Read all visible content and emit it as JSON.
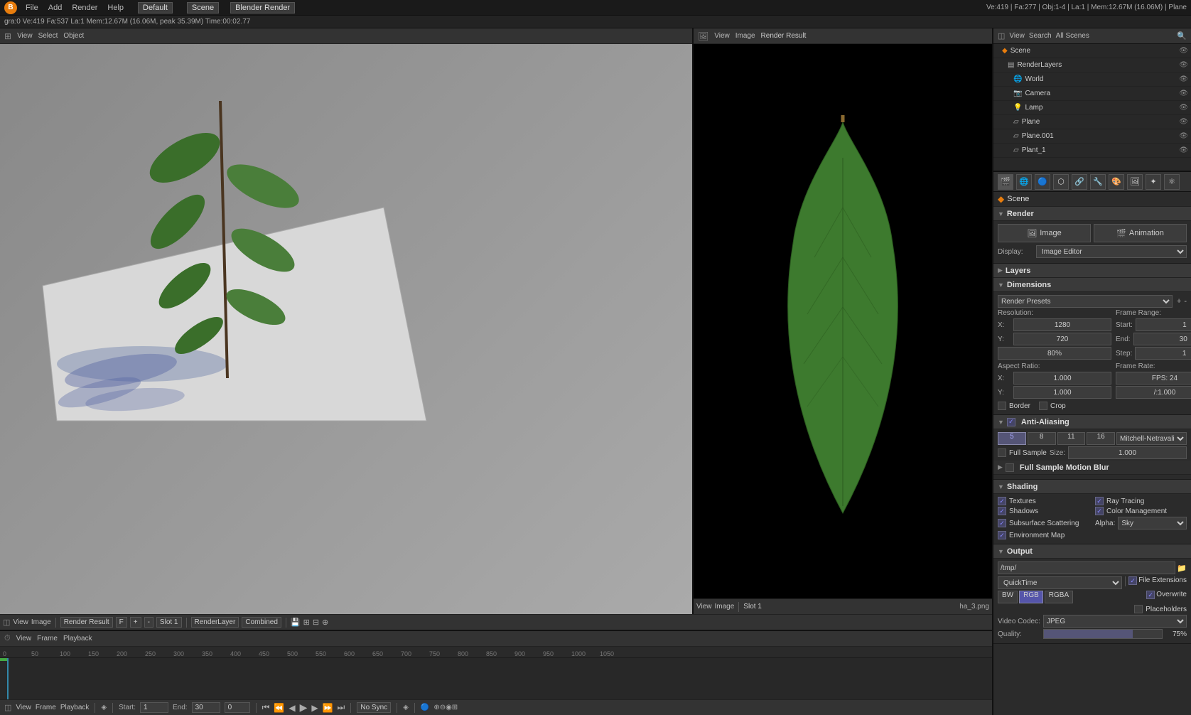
{
  "topbar": {
    "logo": "B",
    "menus": [
      "File",
      "Add",
      "Render",
      "Help"
    ],
    "layout": "Default",
    "scene": "Scene",
    "render_engine": "Blender Render",
    "info": "Ve:419 | Fa:277 | Obj:1-4 | La:1 | Mem:12.67M (16.06M) | Plane"
  },
  "infobar": {
    "text": "gra:0  Ve:419 Fa:537 La:1 Mem:12.67M (16.06M, peak 35.39M) Time:00:02.77"
  },
  "viewport3d": {
    "header_items": [
      "View",
      "Select",
      "Object"
    ]
  },
  "viewport_render": {
    "title": "Render Result",
    "slot": "Slot 1",
    "render_layer": "RenderLayer",
    "combined": "Combined"
  },
  "outliner": {
    "title": "Scene",
    "items": [
      {
        "indent": 0,
        "icon": "◆",
        "label": "Scene"
      },
      {
        "indent": 1,
        "icon": "▤",
        "label": "RenderLayers"
      },
      {
        "indent": 2,
        "icon": "🌐",
        "label": "World"
      },
      {
        "indent": 2,
        "icon": "📷",
        "label": "Camera"
      },
      {
        "indent": 2,
        "icon": "💡",
        "label": "Lamp"
      },
      {
        "indent": 2,
        "icon": "▱",
        "label": "Plane"
      },
      {
        "indent": 2,
        "icon": "▱",
        "label": "Plane.001"
      },
      {
        "indent": 2,
        "icon": "▱",
        "label": "Plant_1"
      }
    ]
  },
  "properties": {
    "scene_label": "Scene",
    "sections": {
      "render": {
        "label": "Render",
        "image_btn": "Image",
        "animation_btn": "Animation",
        "display_label": "Display:",
        "display_value": "Image Editor"
      },
      "layers": {
        "label": "Layers"
      },
      "dimensions": {
        "label": "Dimensions",
        "presets_label": "Render Presets",
        "resolution_label": "Resolution:",
        "x_label": "X:",
        "x_value": "1280",
        "y_label": "Y:",
        "y_value": "720",
        "percent": "80%",
        "frame_range_label": "Frame Range:",
        "start_label": "Start:",
        "start_value": "1",
        "end_label": "End:",
        "end_value": "30",
        "step_label": "Step:",
        "step_value": "1",
        "aspect_label": "Aspect Ratio:",
        "ax_value": "1.000",
        "ay_value": "1.000",
        "fps_label": "Frame Rate:",
        "fps_value": "FPS: 24",
        "fps_multiplier": "/:1.000",
        "border_label": "Border",
        "crop_label": "Crop"
      },
      "anti_aliasing": {
        "label": "Anti-Aliasing",
        "samples": [
          "5",
          "8",
          "11",
          "16"
        ],
        "active_sample": "5",
        "filter": "Mitchell-Netravali",
        "full_sample_label": "Full Sample",
        "size_label": "Size:",
        "size_value": "1.000",
        "motion_blur_label": "Full Sample Motion Blur"
      },
      "shading": {
        "label": "Shading",
        "items": [
          {
            "label": "Textures",
            "checked": true
          },
          {
            "label": "Ray Tracing",
            "checked": true
          },
          {
            "label": "Shadows",
            "checked": true
          },
          {
            "label": "Color Management",
            "checked": true
          },
          {
            "label": "Subsurface Scattering",
            "checked": true
          },
          {
            "label": "Alpha:",
            "type": "dropdown",
            "value": "Sky"
          },
          {
            "label": "Environment Map",
            "checked": true
          }
        ]
      },
      "output": {
        "label": "Output",
        "path": "/tmp/",
        "format_quicktime": "QuickTime",
        "bw": "BW",
        "rgb": "RGB",
        "rgba": "RGBA",
        "file_extensions_label": "File Extensions",
        "overwrite_label": "Overwrite",
        "placeholders_label": "Placeholders",
        "codec_label": "Video Codec:",
        "codec_value": "JPEG",
        "quality_label": "Quality:",
        "quality_value": "75%"
      }
    }
  },
  "timeline": {
    "start_label": "Start:",
    "start_value": "1",
    "end_label": "End:",
    "end_value": "30",
    "current_frame": "0",
    "no_sync": "No Sync",
    "ruler_marks": [
      "0",
      "50",
      "100",
      "150",
      "200",
      "250",
      "300",
      "350",
      "400",
      "450",
      "500",
      "550",
      "600",
      "650",
      "700",
      "750",
      "800",
      "850",
      "900",
      "950",
      "1000",
      "1050"
    ]
  },
  "playback_bar": {
    "view_label": "View",
    "frame_label": "Frame",
    "playback_label": "Playback",
    "start_label": "Start:",
    "start_value": "1",
    "end_label": "End:",
    "end_value": "30",
    "current": "0"
  }
}
